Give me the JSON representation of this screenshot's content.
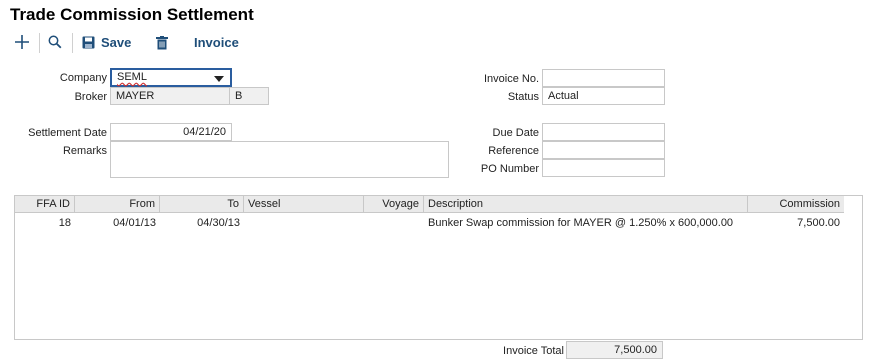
{
  "page": {
    "title": "Trade Commission Settlement"
  },
  "toolbar": {
    "add_icon": "plus-icon",
    "search_icon": "magnifier-icon",
    "save_label": "Save",
    "delete_icon": "trash-icon",
    "invoice_label": "Invoice"
  },
  "form": {
    "company_label": "Company",
    "company_value": "SEML",
    "broker_label": "Broker",
    "broker_value": "MAYER",
    "broker_code": "B",
    "settlement_date_label": "Settlement Date",
    "settlement_date_value": "04/21/20",
    "remarks_label": "Remarks",
    "remarks_value": "",
    "invoice_no_label": "Invoice No.",
    "invoice_no_value": "",
    "status_label": "Status",
    "status_value": "Actual",
    "due_date_label": "Due Date",
    "due_date_value": "",
    "reference_label": "Reference",
    "reference_value": "",
    "po_number_label": "PO Number",
    "po_number_value": ""
  },
  "grid": {
    "columns": [
      "FFA ID",
      "From",
      "To",
      "Vessel",
      "Voyage",
      "Description",
      "Commission"
    ],
    "rows": [
      {
        "ffa_id": "18",
        "from": "04/01/13",
        "to": "04/30/13",
        "vessel": "",
        "voyage": "",
        "description": "Bunker Swap commission for MAYER @ 1.250% x 600,000.00",
        "commission": "7,500.00"
      }
    ]
  },
  "footer": {
    "invoice_total_label": "Invoice Total",
    "invoice_total_value": "7,500.00"
  },
  "colors": {
    "accent": "#1f4e79",
    "focus_border": "#2a5d9f"
  }
}
